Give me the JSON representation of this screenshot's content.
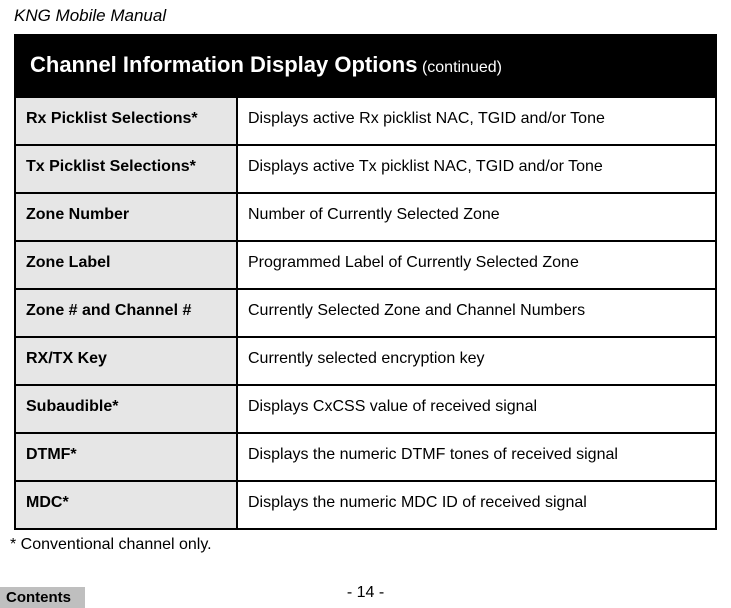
{
  "header": "KNG Mobile Manual",
  "section": {
    "title_main": "Channel Information Display Options",
    "title_sub": "(continued)"
  },
  "rows": [
    {
      "label": "Rx Picklist Selections*",
      "desc": "Displays active Rx picklist NAC, TGID and/or Tone"
    },
    {
      "label": "Tx Picklist Selections*",
      "desc": "Displays active Tx picklist NAC, TGID and/or Tone"
    },
    {
      "label": "Zone Number",
      "desc": "Number of Currently Selected Zone"
    },
    {
      "label": "Zone Label",
      "desc": "Programmed Label of Currently Selected Zone"
    },
    {
      "label": "Zone # and Channel #",
      "desc": "Currently Selected Zone and Channel Numbers"
    },
    {
      "label": "RX/TX Key",
      "desc": "Currently selected encryption key"
    },
    {
      "label": "Subaudible*",
      "desc": "Displays CxCSS value of received signal"
    },
    {
      "label": "DTMF*",
      "desc": "Displays the numeric DTMF tones of received signal"
    },
    {
      "label": "MDC*",
      "desc": "Displays the numeric MDC ID of received signal"
    }
  ],
  "footnote": "* Conventional channel only.",
  "page_number": "- 14 -",
  "contents": "Contents"
}
